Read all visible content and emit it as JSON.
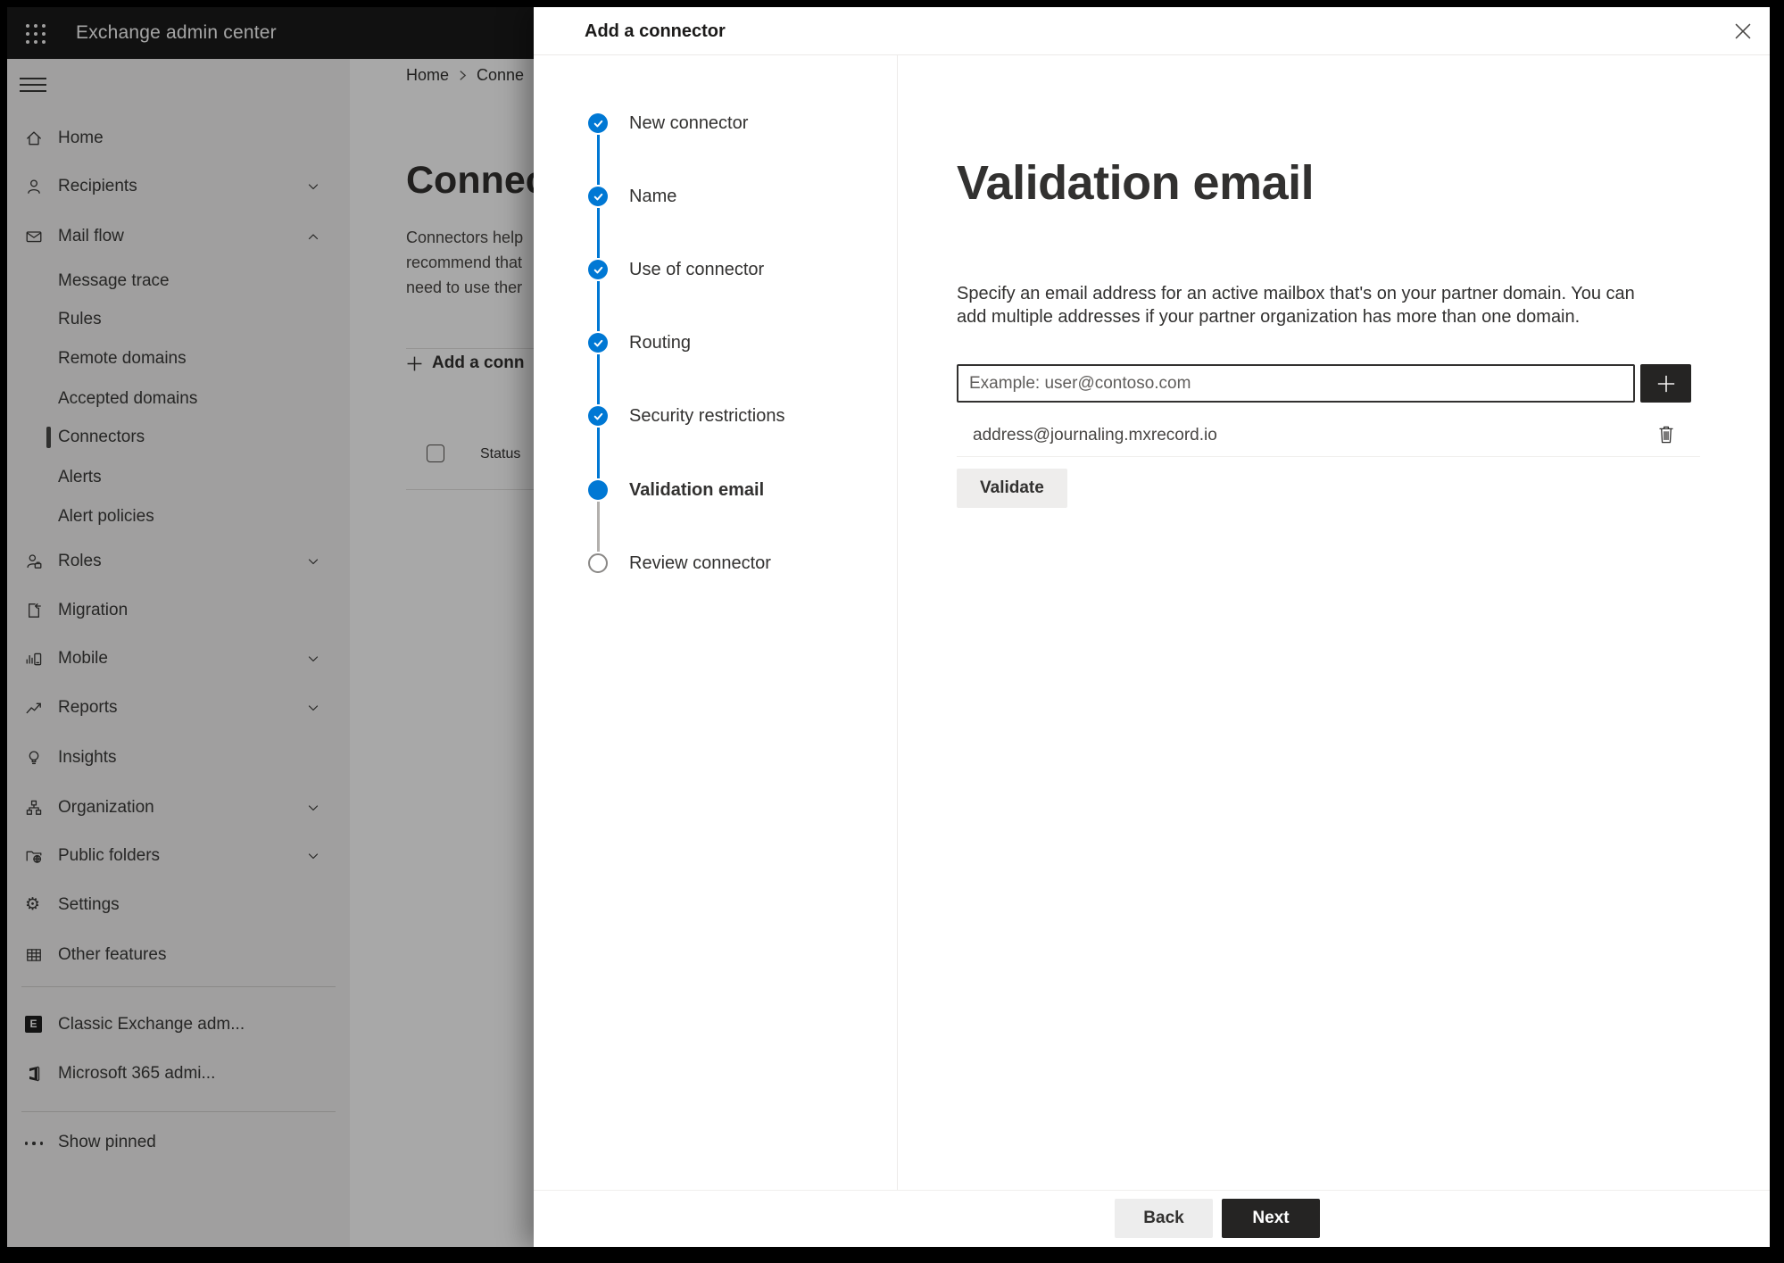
{
  "topbar": {
    "app_title": "Exchange admin center"
  },
  "sidebar": {
    "items": [
      {
        "label": "Home"
      },
      {
        "label": "Recipients"
      },
      {
        "label": "Mail flow"
      },
      {
        "label": "Message trace"
      },
      {
        "label": "Rules"
      },
      {
        "label": "Remote domains"
      },
      {
        "label": "Accepted domains"
      },
      {
        "label": "Connectors",
        "selected": true
      },
      {
        "label": "Alerts"
      },
      {
        "label": "Alert policies"
      },
      {
        "label": "Roles"
      },
      {
        "label": "Migration"
      },
      {
        "label": "Mobile"
      },
      {
        "label": "Reports"
      },
      {
        "label": "Insights"
      },
      {
        "label": "Organization"
      },
      {
        "label": "Public folders"
      },
      {
        "label": "Settings"
      },
      {
        "label": "Other features"
      },
      {
        "label": "Classic Exchange adm..."
      },
      {
        "label": "Microsoft 365 admi..."
      },
      {
        "label": "Show pinned"
      }
    ]
  },
  "page": {
    "breadcrumb": {
      "home": "Home",
      "current": "Conne"
    },
    "title": "Connec",
    "description_lines": [
      "Connectors help",
      "recommend that",
      "need to use ther"
    ],
    "add_connector_label": "Add a conn",
    "table_header": "Status"
  },
  "dialog": {
    "title": "Add a connector",
    "steps": [
      {
        "label": "New connector",
        "state": "done"
      },
      {
        "label": "Name",
        "state": "done"
      },
      {
        "label": "Use of connector",
        "state": "done"
      },
      {
        "label": "Routing",
        "state": "done"
      },
      {
        "label": "Security restrictions",
        "state": "done"
      },
      {
        "label": "Validation email",
        "state": "current"
      },
      {
        "label": "Review connector",
        "state": "todo"
      }
    ],
    "content": {
      "heading": "Validation email",
      "description": "Specify an email address for an active mailbox that's on your partner domain. You can add multiple addresses if your partner organization has more than one domain.",
      "email_input_placeholder": "Example: user@contoso.com",
      "addresses": [
        "address@journaling.mxrecord.io"
      ],
      "validate_label": "Validate"
    },
    "footer": {
      "back_label": "Back",
      "next_label": "Next"
    }
  },
  "colors": {
    "accent": "#0078d4",
    "dark_button": "#252423",
    "sidebar_bg": "#f3f2f1"
  }
}
